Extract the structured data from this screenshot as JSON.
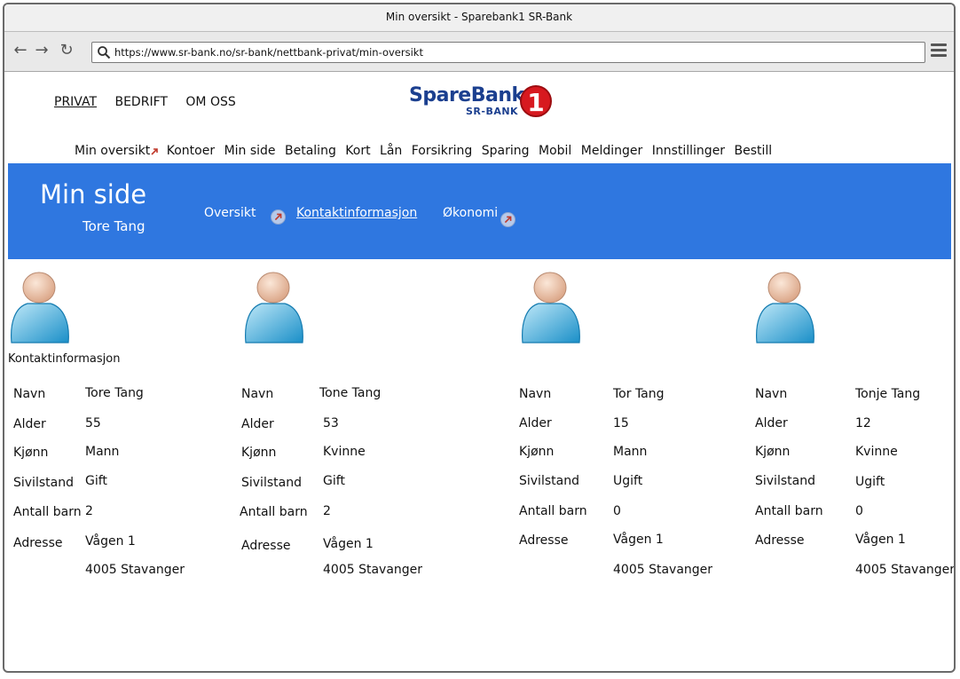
{
  "window": {
    "title": "Min oversikt - Sparebank1 SR-Bank",
    "url": "https://www.sr-bank.no/sr-bank/nettbank-privat/min-oversikt"
  },
  "topnav": [
    {
      "label": "PRIVAT",
      "active": true
    },
    {
      "label": "BEDRIFT",
      "active": false
    },
    {
      "label": "OM OSS",
      "active": false
    }
  ],
  "logo": {
    "main": "SpareBank",
    "sub": "SR-BANK",
    "number": "1"
  },
  "mainnav": [
    "Min oversikt",
    "Kontoer",
    "Min side",
    "Betaling",
    "Kort",
    "Lån",
    "Forsikring",
    "Sparing",
    "Mobil",
    "Meldinger",
    "Innstillinger",
    "Bestill"
  ],
  "banner": {
    "title": "Min side",
    "name": "Tore Tang",
    "subnav": [
      {
        "label": "Oversikt",
        "active": false
      },
      {
        "label": "Kontaktinformasjon",
        "active": true
      },
      {
        "label": "Økonomi",
        "active": false
      }
    ]
  },
  "section_label": "Kontaktinformasjon",
  "field_labels": {
    "name": "Navn",
    "age": "Alder",
    "gender": "Kjønn",
    "marital": "Sivilstand",
    "children": "Antall barn",
    "address": "Adresse"
  },
  "profiles": [
    {
      "name": "Tore Tang",
      "age": "55",
      "gender": "Mann",
      "marital": "Gift",
      "children": "2",
      "street": "Vågen 1",
      "city": "4005 Stavanger"
    },
    {
      "name": "Tone Tang",
      "age": "53",
      "gender": "Kvinne",
      "marital": "Gift",
      "children": "2",
      "street": "Vågen 1",
      "city": "4005 Stavanger"
    },
    {
      "name": "Tor Tang",
      "age": "15",
      "gender": "Mann",
      "marital": "Ugift",
      "children": "0",
      "street": "Vågen 1",
      "city": "4005 Stavanger"
    },
    {
      "name": "Tonje Tang",
      "age": "12",
      "gender": "Kvinne",
      "marital": "Ugift",
      "children": "0",
      "street": "Vågen 1",
      "city": "4005 Stavanger"
    }
  ],
  "colors": {
    "banner": "#2f77e0",
    "brand": "#1b3f8f",
    "logo_red": "#d7191f"
  }
}
